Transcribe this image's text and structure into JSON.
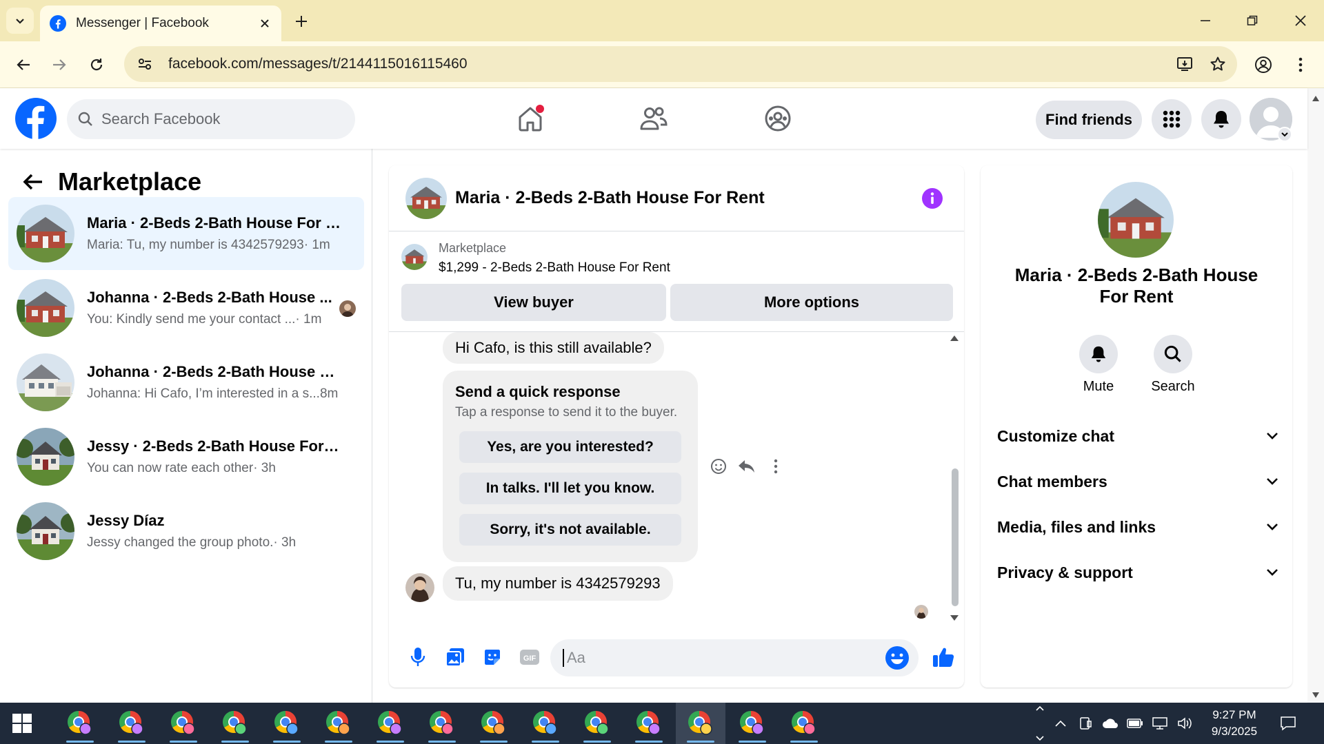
{
  "browser": {
    "tab_title": "Messenger | Facebook",
    "url": "facebook.com/messages/t/2144115016115460"
  },
  "header": {
    "search_placeholder": "Search Facebook",
    "find_friends_label": "Find friends"
  },
  "sidebar": {
    "title": "Marketplace",
    "conversations": [
      {
        "name": "Maria · 2-Beds 2-Bath House For R...",
        "preview": "Maria: Tu, my number is 4342579293",
        "time": "· 1m",
        "active": true
      },
      {
        "name": "Johanna · 2-Beds 2-Bath House ...",
        "preview": "You: Kindly send me your contact ...",
        "time": " · 1m",
        "active": false
      },
      {
        "name": "Johanna · 2-Beds 2-Bath House Fo...",
        "preview": "Johanna: Hi Cafo, I’m interested in a s...",
        "time": " 8m",
        "active": false
      },
      {
        "name": "Jessy · 2-Beds 2-Bath House For R...",
        "preview": "You can now rate each other",
        "time": " · 3h",
        "active": false
      },
      {
        "name": "Jessy Díaz",
        "preview": "Jessy changed the group photo.",
        "time": " · 3h",
        "active": false
      }
    ]
  },
  "chat": {
    "title": "Maria · 2-Beds 2-Bath House For Rent",
    "listing_category": "Marketplace",
    "listing_title": "$1,299 - 2-Beds 2-Bath House For Rent",
    "view_buyer_label": "View buyer",
    "more_options_label": "More options",
    "message_1": "Hi Cafo, is this still available?",
    "quick_title": "Send a quick response",
    "quick_subtitle": "Tap a response to send it to the buyer.",
    "quick_options": [
      "Yes, are you interested?",
      "In talks. I'll let you know.",
      "Sorry, it's not available."
    ],
    "message_2": "Tu, my number is 4342579293",
    "composer_placeholder": "Aa"
  },
  "right_panel": {
    "name": "Maria · 2-Beds 2-Bath House For Rent",
    "mute_label": "Mute",
    "search_label": "Search",
    "sections": [
      "Customize chat",
      "Chat members",
      "Media, files and links",
      "Privacy & support"
    ]
  },
  "taskbar": {
    "time": "9:27 PM",
    "date": "9/3/2025"
  },
  "colors": {
    "fb_blue": "#0866ff",
    "messenger_purple": "#a033ff",
    "tab_bar": "#f3e9b8",
    "taskbar": "#1f2a3a"
  }
}
